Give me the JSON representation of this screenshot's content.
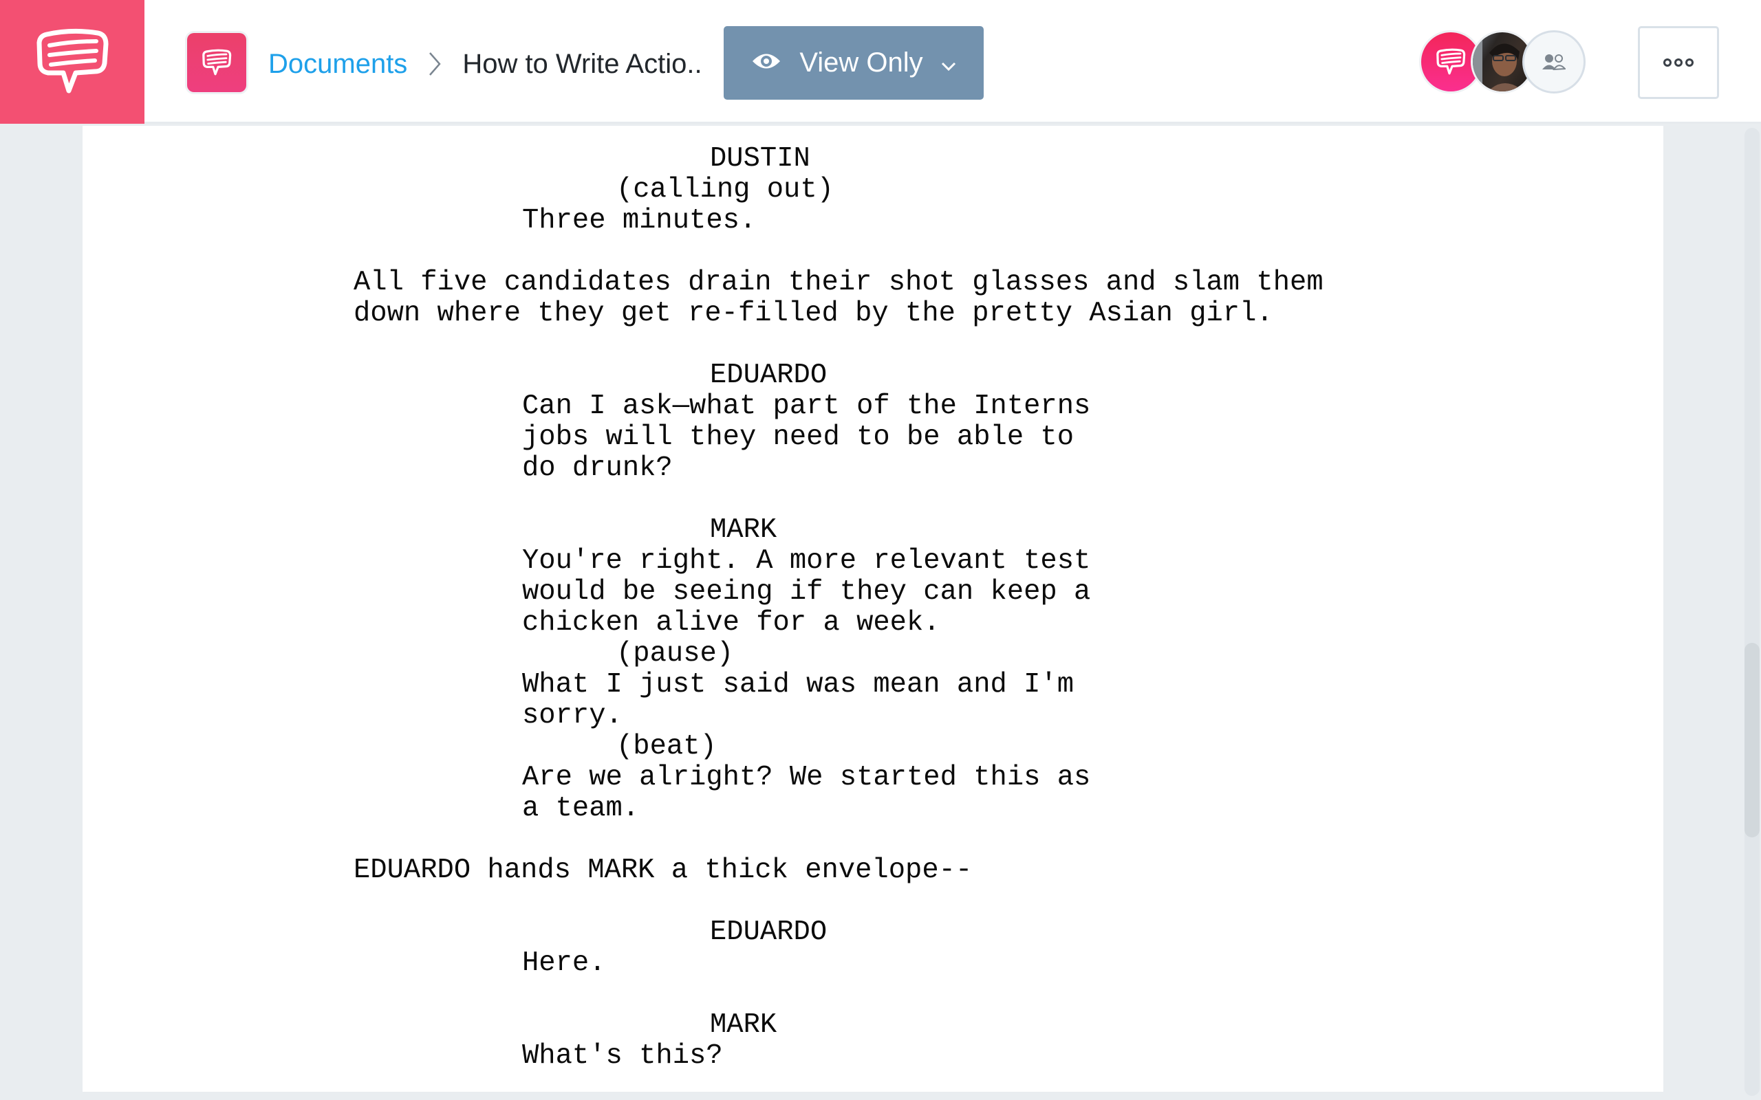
{
  "app": {
    "logo_icon": "chat-bubble-logo-icon",
    "colors": {
      "brand": "#f35072",
      "link": "#1ea0ea",
      "view_button": "#7392ae"
    }
  },
  "header": {
    "doc_icon": "document-chat-icon",
    "breadcrumb": {
      "root": "Documents",
      "separator_icon": "chevron-right-icon",
      "current": "How to Write Actio.."
    },
    "view_mode": {
      "icon": "eye-icon",
      "label": "View Only",
      "dropdown_icon": "chevron-down-icon"
    },
    "collaborators": [
      {
        "type": "brand",
        "icon": "chat-bubble-icon"
      },
      {
        "type": "photo",
        "icon": "user-photo"
      },
      {
        "type": "team",
        "icon": "team-icon"
      }
    ],
    "more_icon": "more-options-icon"
  },
  "script": {
    "lines": [
      {
        "type": "character",
        "text": "DUSTIN"
      },
      {
        "type": "parenthetical",
        "text": "(calling out)"
      },
      {
        "type": "dialogue",
        "text": "Three minutes."
      },
      {
        "type": "blank",
        "text": ""
      },
      {
        "type": "action",
        "text": "All five candidates drain their shot glasses and slam them"
      },
      {
        "type": "action",
        "text": "down where they get re-filled by the pretty Asian girl."
      },
      {
        "type": "blank",
        "text": ""
      },
      {
        "type": "character",
        "text": "EDUARDO"
      },
      {
        "type": "dialogue",
        "text": "Can I ask—what part of the Interns"
      },
      {
        "type": "dialogue",
        "text": "jobs will they need to be able to"
      },
      {
        "type": "dialogue",
        "text": "do drunk?"
      },
      {
        "type": "blank",
        "text": ""
      },
      {
        "type": "character",
        "text": "MARK"
      },
      {
        "type": "dialogue",
        "text": "You're right. A more relevant test"
      },
      {
        "type": "dialogue",
        "text": "would be seeing if they can keep a"
      },
      {
        "type": "dialogue",
        "text": "chicken alive for a week."
      },
      {
        "type": "parenthetical",
        "text": "(pause)"
      },
      {
        "type": "dialogue",
        "text": "What I just said was mean and I'm"
      },
      {
        "type": "dialogue",
        "text": "sorry."
      },
      {
        "type": "parenthetical",
        "text": "(beat)"
      },
      {
        "type": "dialogue",
        "text": "Are we alright? We started this as"
      },
      {
        "type": "dialogue",
        "text": "a team."
      },
      {
        "type": "blank",
        "text": ""
      },
      {
        "type": "action",
        "text": "EDUARDO hands MARK a thick envelope--"
      },
      {
        "type": "blank",
        "text": ""
      },
      {
        "type": "character",
        "text": "EDUARDO"
      },
      {
        "type": "dialogue",
        "text": "Here."
      },
      {
        "type": "blank",
        "text": ""
      },
      {
        "type": "character",
        "text": "MARK"
      },
      {
        "type": "dialogue",
        "text": "What's this?"
      }
    ]
  }
}
